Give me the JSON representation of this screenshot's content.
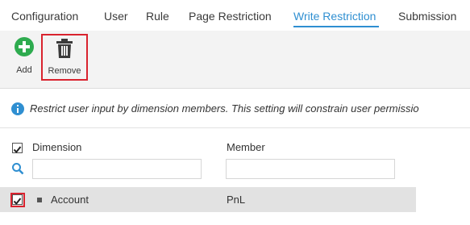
{
  "tabs": [
    {
      "label": "Configuration"
    },
    {
      "label": "User"
    },
    {
      "label": "Rule"
    },
    {
      "label": "Page Restriction"
    },
    {
      "label": "Write Restriction",
      "active": true
    },
    {
      "label": "Submission"
    }
  ],
  "toolbar": {
    "add_label": "Add",
    "remove_label": "Remove",
    "add_icon": "plus-circle-icon",
    "remove_icon": "trash-icon"
  },
  "info": {
    "icon": "info-circle-icon",
    "text": "Restrict user input by dimension members. This setting will constrain user permissio"
  },
  "grid": {
    "columns": {
      "dimension": "Dimension",
      "member": "Member"
    },
    "filter": {
      "dimension_value": "",
      "member_value": ""
    },
    "rows": [
      {
        "checked": true,
        "dimension": "Account",
        "member": "PnL"
      }
    ],
    "header_checked": true
  },
  "colors": {
    "accent": "#2f8fd1",
    "add_green": "#2eab4f",
    "highlight_red": "#d9232e",
    "row_bg": "#e2e2e2"
  }
}
